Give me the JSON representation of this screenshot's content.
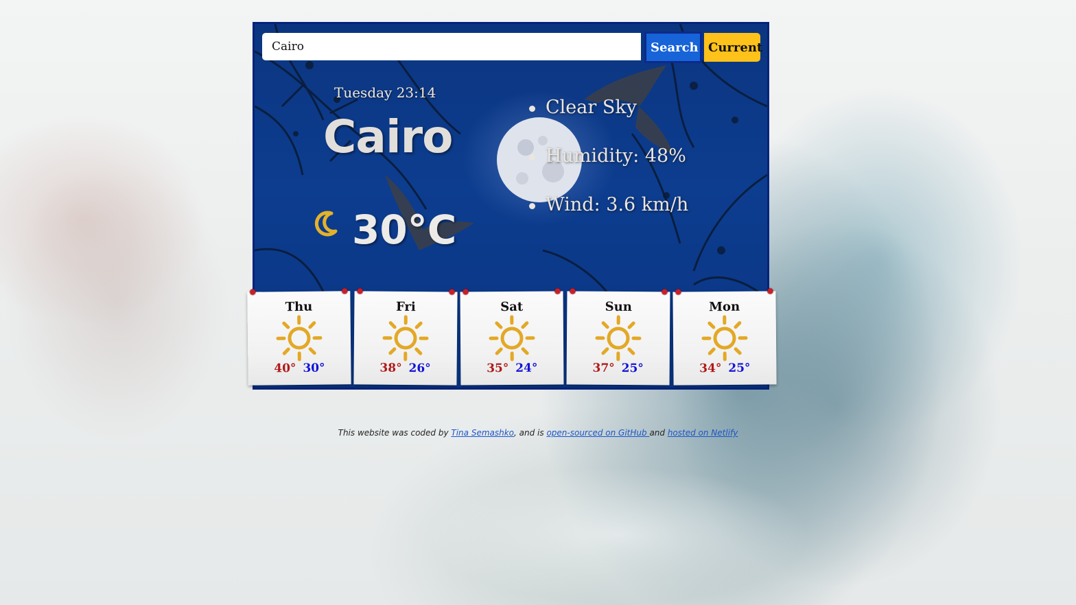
{
  "search": {
    "value": "Cairo",
    "search_label": "Search",
    "current_label": "Current"
  },
  "weather": {
    "datetime": "Tuesday 23:14",
    "city": "Cairo",
    "temperature": "30°C",
    "icon": "moon-icon",
    "details": [
      "Clear Sky",
      "Humidity: 48%",
      "Wind: 3.6 km/h"
    ]
  },
  "forecast": [
    {
      "day": "Thu",
      "max": "40°",
      "min": "30°",
      "icon": "sun-icon"
    },
    {
      "day": "Fri",
      "max": "38°",
      "min": "26°",
      "icon": "sun-icon"
    },
    {
      "day": "Sat",
      "max": "35°",
      "min": "24°",
      "icon": "sun-icon"
    },
    {
      "day": "Sun",
      "max": "37°",
      "min": "25°",
      "icon": "sun-icon"
    },
    {
      "day": "Mon",
      "max": "34°",
      "min": "25°",
      "icon": "sun-icon"
    }
  ],
  "footer": {
    "text1": "This website was coded by ",
    "author": "Tina Semashko",
    "text2": ", and is ",
    "github": "open-sourced on GitHub ",
    "text3": "and ",
    "netlify": "hosted on Netlify"
  },
  "colors": {
    "search_button": "#1763d8",
    "current_button": "#ffc21a",
    "max_temp": "#b01818",
    "min_temp": "#1212d8",
    "panel_border": "#06237a"
  }
}
